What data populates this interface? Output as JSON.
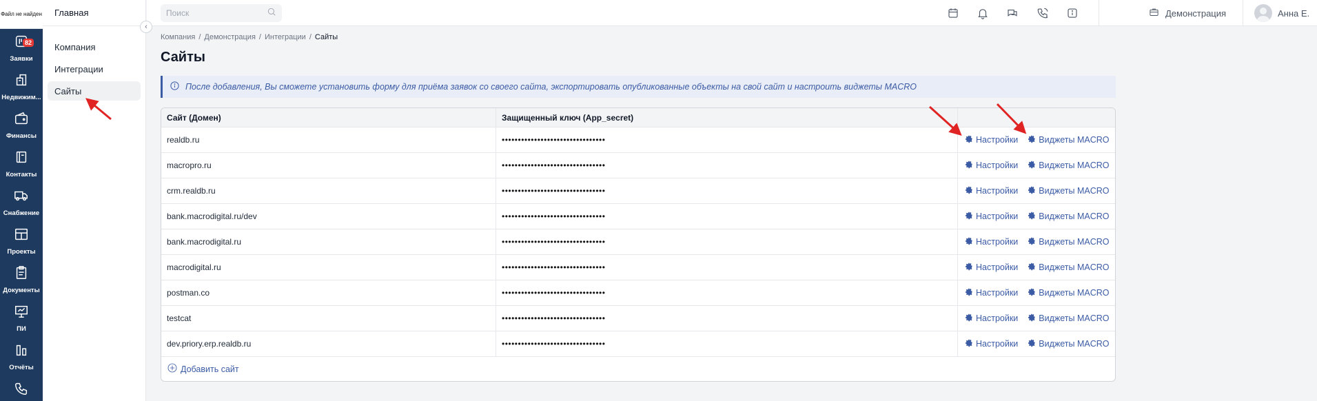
{
  "rail": {
    "logo_text": "Файл не найден",
    "items": [
      {
        "label": "Заявки",
        "icon": "requests-icon",
        "badge": "82"
      },
      {
        "label": "Недвижим...",
        "icon": "realty-icon"
      },
      {
        "label": "Финансы",
        "icon": "wallet-icon"
      },
      {
        "label": "Контакты",
        "icon": "contacts-icon"
      },
      {
        "label": "Снабжение",
        "icon": "truck-icon"
      },
      {
        "label": "Проекты",
        "icon": "projects-icon"
      },
      {
        "label": "Документы",
        "icon": "documents-icon"
      },
      {
        "label": "ПИ",
        "icon": "presentation-icon"
      },
      {
        "label": "Отчёты",
        "icon": "reports-icon"
      },
      {
        "label": "Звонки",
        "icon": "phone-icon"
      }
    ]
  },
  "subnav": {
    "title": "Главная",
    "items": [
      {
        "label": "Компания",
        "active": false
      },
      {
        "label": "Интеграции",
        "active": false
      },
      {
        "label": "Сайты",
        "active": true
      }
    ]
  },
  "topbar": {
    "search_placeholder": "Поиск",
    "workspace": "Демонстрация",
    "user_name": "Анна Е."
  },
  "breadcrumb": [
    "Компания",
    "Демонстрация",
    "Интеграции",
    "Сайты"
  ],
  "page_title": "Сайты",
  "info_text": "После добавления, Вы сможете установить форму для приёма заявок со своего сайта, экспортировать опубликованные объекты на свой сайт и настроить виджеты MACRO",
  "table": {
    "columns": [
      "Сайт (Домен)",
      "Защищенный ключ (App_secret)",
      ""
    ],
    "settings_label": "Настройки",
    "widgets_label": "Виджеты MACRO",
    "rows": [
      {
        "domain": "realdb.ru",
        "secret": "••••••••••••••••••••••••••••••••"
      },
      {
        "domain": "macropro.ru",
        "secret": "••••••••••••••••••••••••••••••••"
      },
      {
        "domain": "crm.realdb.ru",
        "secret": "••••••••••••••••••••••••••••••••"
      },
      {
        "domain": "bank.macrodigital.ru/dev",
        "secret": "••••••••••••••••••••••••••••••••"
      },
      {
        "domain": "bank.macrodigital.ru",
        "secret": "••••••••••••••••••••••••••••••••"
      },
      {
        "domain": "macrodigital.ru",
        "secret": "••••••••••••••••••••••••••••••••"
      },
      {
        "domain": "postman.co",
        "secret": "••••••••••••••••••••••••••••••••"
      },
      {
        "domain": "testcat",
        "secret": "••••••••••••••••••••••••••••••••"
      },
      {
        "domain": "dev.priory.erp.realdb.ru",
        "secret": "••••••••••••••••••••••••••••••••"
      }
    ],
    "add_label": "Добавить сайт"
  },
  "colors": {
    "rail_bg": "#1e3a5f",
    "accent": "#3b5ba5",
    "badge": "#e53935",
    "annotation_arrow": "#e02424"
  }
}
